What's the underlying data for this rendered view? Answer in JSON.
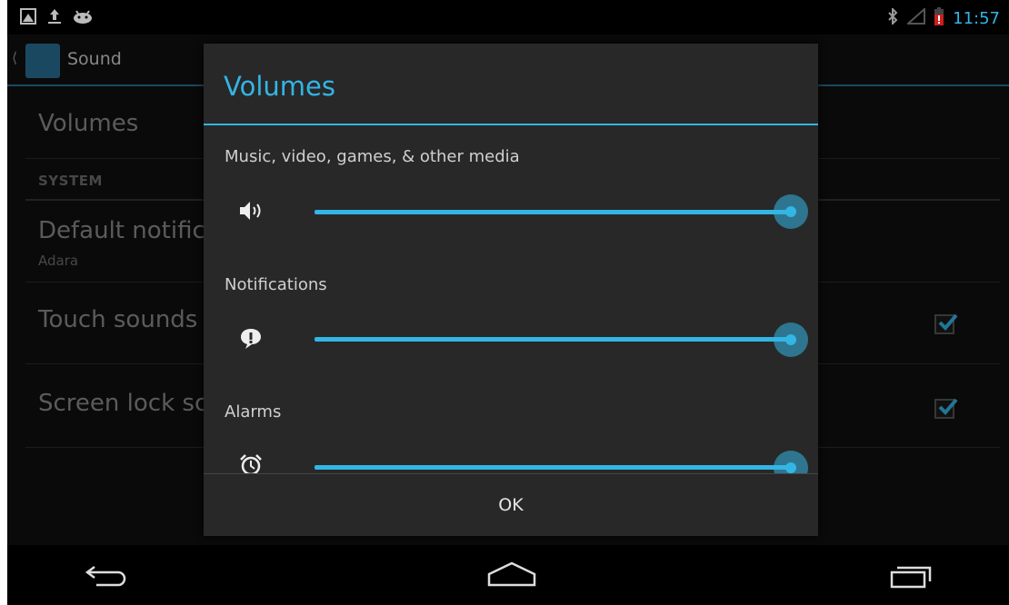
{
  "status_bar": {
    "time": "11:57",
    "left_icons": [
      "screenshot-icon",
      "upload-icon",
      "android-icon"
    ],
    "right_icons": [
      "bluetooth-icon",
      "signal-icon",
      "battery-icon"
    ],
    "accent": "#33b5e5"
  },
  "action_bar": {
    "title": "Sound"
  },
  "settings": {
    "volumes_label": "Volumes",
    "section_system": "SYSTEM",
    "default_notification_title": "Default notific",
    "default_notification_value": "Adara",
    "touch_sounds_title": "Touch sounds",
    "touch_sounds_checked": true,
    "screen_lock_title": "Screen lock sc",
    "screen_lock_checked": true
  },
  "dialog": {
    "title": "Volumes",
    "items": [
      {
        "label": "Music, video, games, & other media",
        "icon": "speaker-icon",
        "level": 1.0
      },
      {
        "label": "Notifications",
        "icon": "notification-icon",
        "level": 1.0
      },
      {
        "label": "Alarms",
        "icon": "alarm-icon",
        "level": 1.0
      }
    ],
    "ok_label": "OK"
  },
  "nav_bar": {
    "buttons": [
      "back-icon",
      "home-icon",
      "recent-apps-icon"
    ]
  }
}
